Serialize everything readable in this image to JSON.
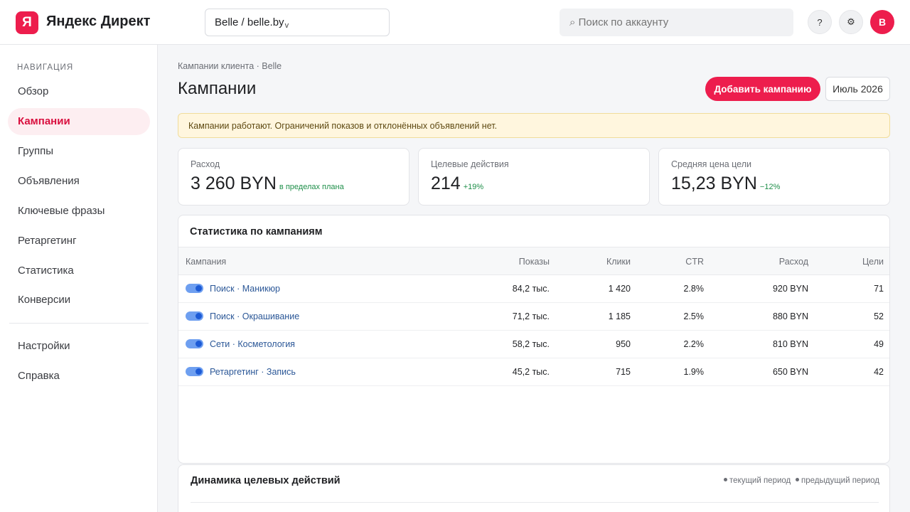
{
  "header": {
    "logo_letter": "Я",
    "logo_text": "Яндекс Директ",
    "account": "Belle / belle.by",
    "search_placeholder": "⌕ Поиск по аккаунту",
    "help": "?",
    "settings": "⚙",
    "avatar": "B",
    "brand_color": "#ed1d4d"
  },
  "sidebar": {
    "title": "НАВИГАЦИЯ",
    "items": [
      {
        "label": "Обзор"
      },
      {
        "label": "Кампании",
        "active": true
      },
      {
        "label": "Группы"
      },
      {
        "label": "Объявления"
      },
      {
        "label": "Ключевые фразы"
      },
      {
        "label": "Ретаргетинг"
      },
      {
        "label": "Статистика"
      },
      {
        "label": "Конверсии"
      }
    ],
    "bottom_items": [
      {
        "label": "Настройки"
      },
      {
        "label": "Справка"
      }
    ]
  },
  "main": {
    "breadcrumb": "Кампании клиента · Belle",
    "title": "Кампании",
    "add_button": "Добавить кампанию",
    "date_button": "Июль 2026",
    "alert": "Кампании работают. Ограничений показов и отклонённых объявлений нет.",
    "kpis": [
      {
        "label": "Расход",
        "value": "3 260 BYN",
        "delta": "в пределах плана"
      },
      {
        "label": "Целевые действия",
        "value": "214",
        "delta": "+19%"
      },
      {
        "label": "Средняя цена цели",
        "value": "15,23 BYN",
        "delta": "−12%"
      }
    ],
    "table": {
      "title": "Статистика по кампаниям",
      "columns": [
        "Кампания",
        "Показы",
        "Клики",
        "CTR",
        "Расход",
        "Цели"
      ],
      "rows": [
        {
          "name": "Поиск · Маникюр",
          "shows": "84,2 тыс.",
          "clicks": "1 420",
          "ctr": "2.8%",
          "spend": "920 BYN",
          "goals": "71",
          "enabled": true
        },
        {
          "name": "Поиск · Окрашивание",
          "shows": "71,2 тыс.",
          "clicks": "1 185",
          "ctr": "2.5%",
          "spend": "880 BYN",
          "goals": "52",
          "enabled": true
        },
        {
          "name": "Сети · Косметология",
          "shows": "58,2 тыс.",
          "clicks": "950",
          "ctr": "2.2%",
          "spend": "810 BYN",
          "goals": "49",
          "enabled": true
        },
        {
          "name": "Ретаргетинг · Запись",
          "shows": "45,2 тыс.",
          "clicks": "715",
          "ctr": "1.9%",
          "spend": "650 BYN",
          "goals": "42",
          "enabled": true
        }
      ]
    },
    "dynamics": {
      "title": "Динамика целевых действий",
      "legend_current": "текущий период",
      "legend_previous": "предыдущий период"
    }
  }
}
